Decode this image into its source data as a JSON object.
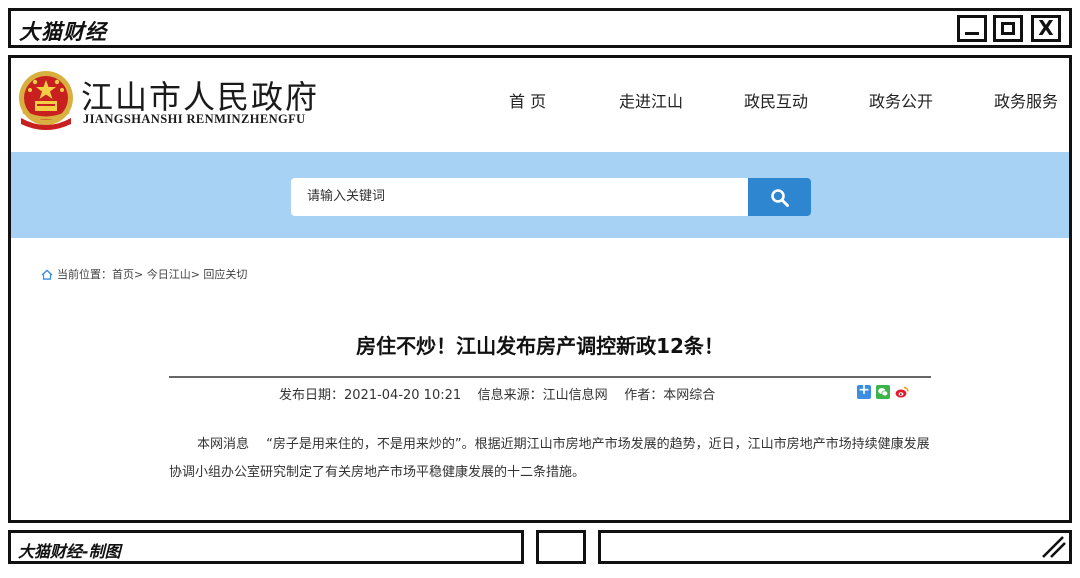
{
  "app": {
    "title": "大猫财经",
    "close_glyph": "X",
    "credit": "大猫财经-制图"
  },
  "site": {
    "name": "江山市人民政府",
    "pinyin": "JIANGSHANSHI RENMINZHENGFU",
    "nav": [
      "首 页",
      "走进江山",
      "政民互动",
      "政务公开",
      "政务服务"
    ],
    "search_placeholder": "请输入关键词",
    "search_icon": "magnifier-icon",
    "search_band_color": "#a7d2f4",
    "search_button_color": "#2f86d0"
  },
  "breadcrumb": {
    "text": "当前位置：首页> 今日江山> 回应关切"
  },
  "article": {
    "title": "房住不炒！江山发布房产调控新政12条！",
    "meta": "发布日期：2021-04-20 10:21    信息来源：江山信息网    作者：本网综合",
    "share_icons": [
      "share-plus-icon",
      "wechat-icon",
      "weibo-icon"
    ],
    "body": "本网消息　 “房子是用来住的，不是用来炒的”。根据近期江山市房地产市场发展的趋势，近日，江山市房地产市场持续健康发展协调小组办公室研究制定了有关房地产市场平稳健康发展的十二条措施。"
  }
}
